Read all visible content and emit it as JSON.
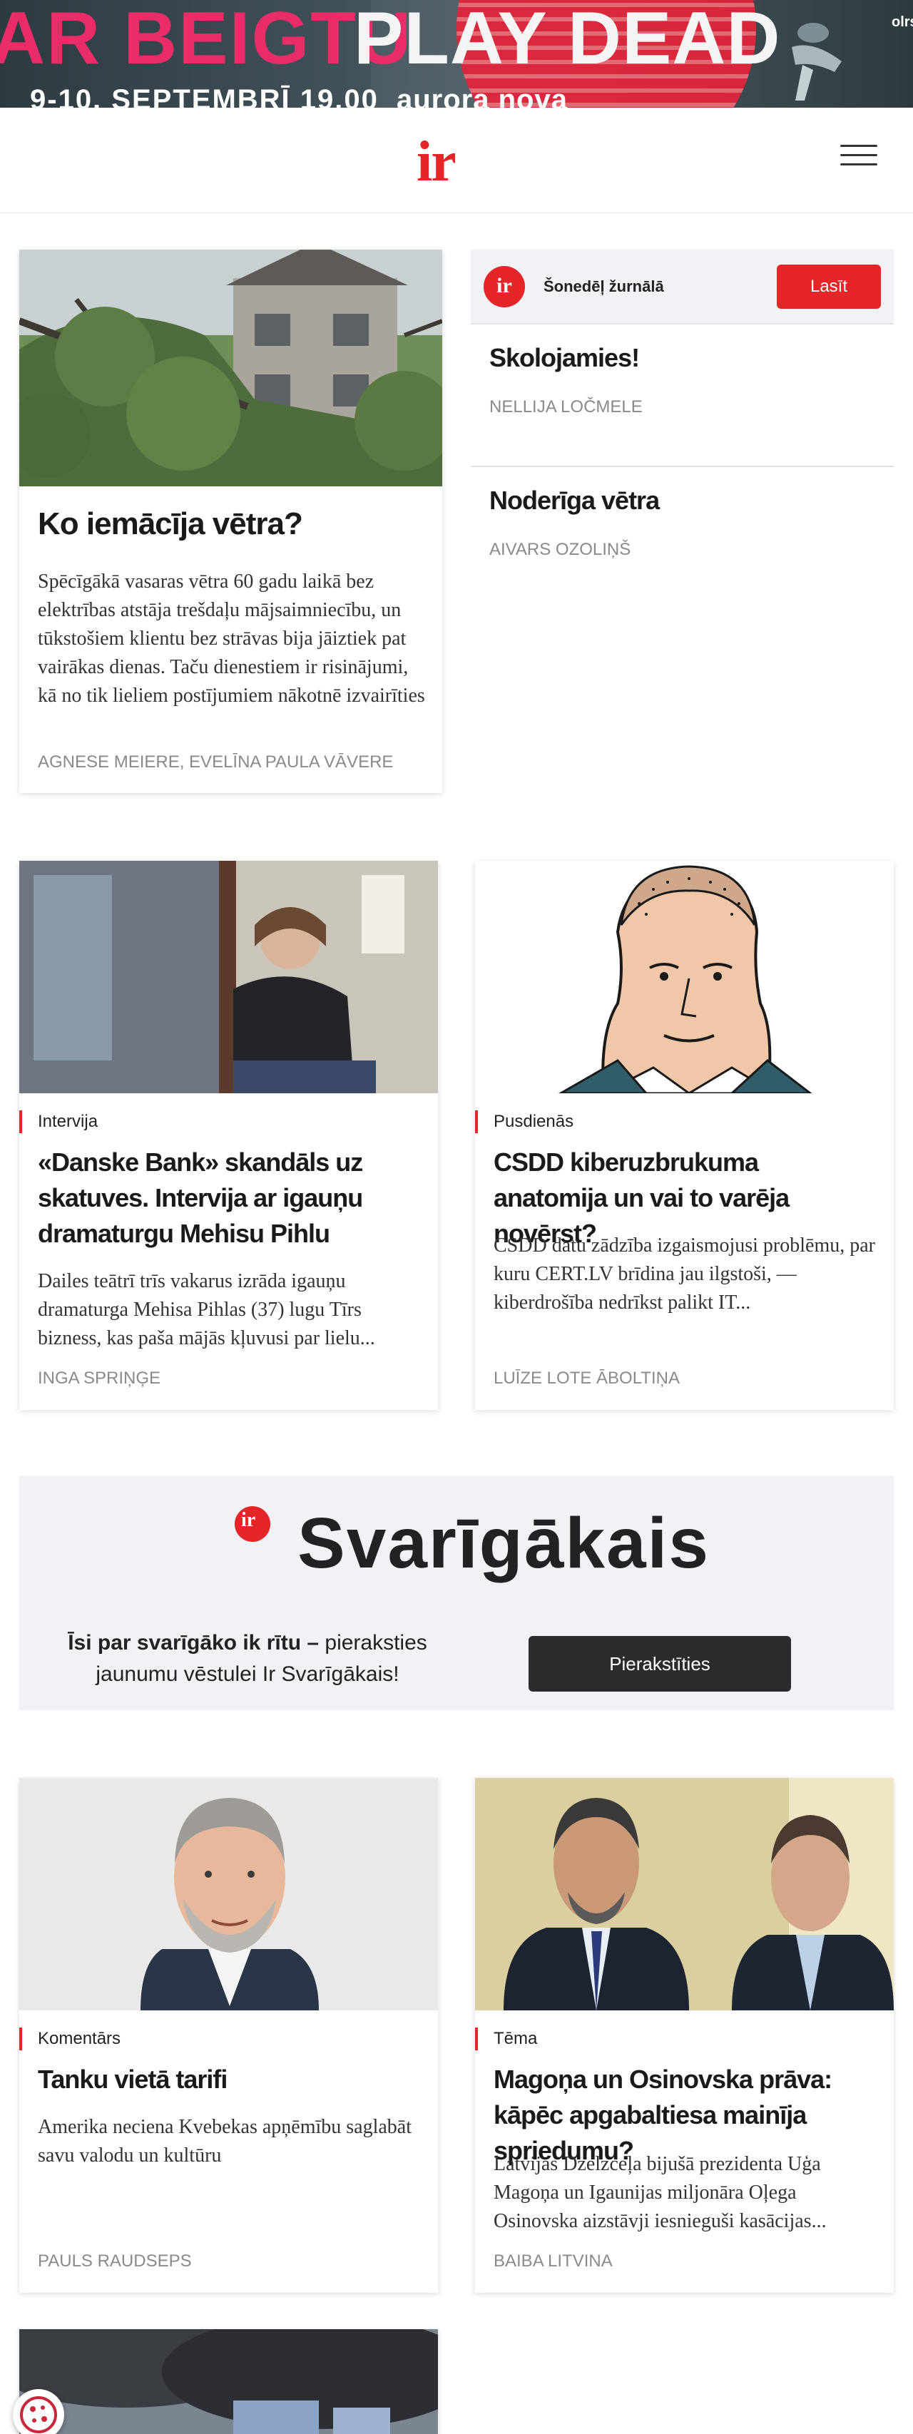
{
  "banner": {
    "headline_left": "AR BEIGTU",
    "headline_right": "PLAY DEAD",
    "dates": "9-10. SEPTEMBRĪ 19.00",
    "venue": "aurora nova",
    "corner": "olrs"
  },
  "header": {
    "logo": "ir",
    "menu_icon": "hamburger-menu-icon"
  },
  "lead": {
    "title": "Ko iemācīja vētra?",
    "summary": "Spēcīgākā vasaras vētra 60 gadu laikā bez elektrības atstāja trešdaļu mājsaimniecību, un tūkstošiem klientu bez strāvas bija jāiztiek pat vairākas dienas. Taču dienestiem ir risinājumi, kā no tik lieliem postījumiem nākotnē izvairīties",
    "author": "AGNESE MEIERE, EVELĪNA PAULA VĀVERE"
  },
  "sidebar": {
    "magazine": {
      "badge": "ir",
      "label": "Šonedēļ žurnālā",
      "button": "Lasīt"
    },
    "items": [
      {
        "title": "Skolojamies!",
        "author": "NELLIJA LOČMELE"
      },
      {
        "title": "Noderīga vētra",
        "author": "AIVARS OZOLIŅŠ"
      }
    ]
  },
  "cards": [
    {
      "rubric": "Intervija",
      "title": "«Danske Bank» skandāls uz skatuves. Intervija ar igauņu dramaturgu Mehisu Pihlu",
      "summary": "Dailes teātrī trīs vakarus izrāda igauņu dramaturga Mehisa Pihlas (37) lugu Tīrs bizness, kas paša mājās kļuvusi par lielu...",
      "author": "INGA SPRIŅĢE"
    },
    {
      "rubric": "Pusdienās",
      "title": "CSDD kiberuzbrukuma anatomija un vai to varēja novērst?",
      "summary": "CSDD datu zādzība izgaismojusi problēmu, par kuru CERT.LV brīdina jau ilgstoši, — kiberdrošība nedrīkst palikt IT...",
      "author": "LUĪZE LOTE ĀBOLTIŅA"
    },
    {
      "rubric": "Komentārs",
      "title": "Tanku vietā tarifi",
      "summary": "Amerika neciena Kvebekas apņēmību saglabāt savu valodu un kultūru",
      "author": "PAULS RAUDSEPS"
    },
    {
      "rubric": "Tēma",
      "title": "Magoņa un Osinovska prāva: kāpēc apgabaltiesa mainīja spriedumu?",
      "summary": "Latvijas Dzelzceļa bijušā prezidenta Uģa Magoņa un Igaunijas miljonāra Oļega Osinovska aizstāvji iesnieguši kasācijas...",
      "author": "BAIBA LITVINA"
    }
  ],
  "newsletter": {
    "badge": "ir",
    "title": "Svarīgākais",
    "text_bold": "Īsi par svarīgāko ik rītu –",
    "text_rest": " pieraksties jaunumu vēstulei Ir Svarīgākais!",
    "button": "Pierakstīties"
  },
  "cookie": {
    "icon": "cookie-settings-icon"
  },
  "colors": {
    "brand_red": "#e52528",
    "panel_gray": "#f0f2f5",
    "dark_button": "#2b2b2b",
    "muted_text": "#8a8a8a"
  }
}
